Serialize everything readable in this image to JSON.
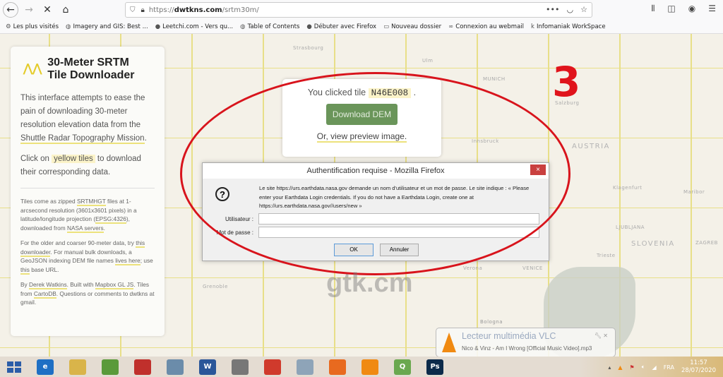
{
  "browser": {
    "url_prefix": "https://",
    "url_host": "dwtkns.com",
    "url_path": "/srtm30m/",
    "nav_icons": [
      "back-icon",
      "forward-icon",
      "stop-icon",
      "home-icon"
    ],
    "bookmarks": [
      {
        "icon": "gear-icon",
        "label": "Les plus visités"
      },
      {
        "icon": "globe-icon",
        "label": "Imagery and GIS: Best ..."
      },
      {
        "icon": "leetchi-icon",
        "label": "Leetchi.com - Vers qu..."
      },
      {
        "icon": "globe-icon",
        "label": "Table of Contents"
      },
      {
        "icon": "firefox-icon",
        "label": "Débuter avec Firefox"
      },
      {
        "icon": "folder-icon",
        "label": "Nouveau dossier"
      },
      {
        "icon": "webmail-icon",
        "label": "Connexion au webmail"
      },
      {
        "icon": "infomaniak-icon",
        "label": "Infomaniak WorkSpace"
      }
    ]
  },
  "panel": {
    "title_line1": "30-Meter SRTM",
    "title_line2": "Tile Downloader",
    "intro": "This interface attempts to ease the pain of downloading 30-meter resolution elevation data from the",
    "intro_link": "Shuttle Radar Topography Mission",
    "intro_end": ".",
    "click_pre": "Click on",
    "click_hl": "yellow tiles",
    "click_post": "to download their corresponding data.",
    "tiles_a": "Tiles come as zipped",
    "tiles_link1": "SRTMHGT",
    "tiles_b": "files at 1-arcsecond resolution (3601x3601 pixels) in a latitude/longitude projection (",
    "tiles_link2": "EPSG:4326",
    "tiles_c": "), downloaded from",
    "tiles_link3": "NASA servers",
    "tiles_d": ".",
    "older_a": "For the older and coarser 90-meter data, try",
    "older_link1": "this downloader",
    "older_b": ". For manual bulk downloads, a GeoJSON indexing DEM file names",
    "older_link2": "lives here",
    "older_c": "; use",
    "older_link3": "this",
    "older_d": "base URL.",
    "by_a": "By",
    "by_link1": "Derek Watkins",
    "by_b": ". Built with",
    "by_link2": "Mapbox GL JS",
    "by_c": ". Tiles from",
    "by_link3": "CartoDB",
    "by_d": ". Questions or comments to dwtkns at gmail."
  },
  "popup": {
    "clicked": "You clicked tile",
    "tile": "N46E008",
    "dot": ".",
    "download": "Download DEM",
    "preview": "Or, view preview image."
  },
  "dialog": {
    "title": "Authentification requise - Mozilla Firefox",
    "close": "×",
    "message": "Le site https://urs.earthdata.nasa.gov demande un nom d'utilisateur et un mot de passe. Le site indique : « Please enter your Earthdata Login credentials. If you do not have a Earthdata Login, create one at https://urs.earthdata.nasa.gov//users/new »",
    "user_label": "Utilisateur :",
    "user_value": "",
    "pass_label": "Mot de passe :",
    "pass_value": "",
    "ok": "OK",
    "cancel": "Annuler"
  },
  "map_labels": {
    "strasbourg": "Strasbourg",
    "ulm": "Ulm",
    "munich": "MUNICH",
    "salzburg": "Salzburg",
    "innsbruck": "Innsbruck",
    "austria": "AUSTRIA",
    "klagenfurt": "Klagenfurt",
    "maribor": "Maribor",
    "ljubljana": "LJUBLJANA",
    "slovenia": "SLOVENIA",
    "zagreb": "ZAGREB",
    "trieste": "Trieste",
    "venice": "VENICE",
    "verona": "Verona",
    "grenoble": "Grenoble",
    "bologna": "Bologna"
  },
  "annotation": {
    "number": "3",
    "color": "#d8141c"
  },
  "watermark": "gtk.cm",
  "vlc": {
    "title": "Lecteur multimédia VLC",
    "track": "Nico & Vinz - Am I Wrong [Official Music Video].mp3"
  },
  "taskbar": {
    "apps": [
      {
        "icon": "ie-icon",
        "color": "#1e6fc4",
        "label": "e"
      },
      {
        "icon": "explorer-icon",
        "color": "#d9b44a",
        "label": ""
      },
      {
        "icon": "globe-app-icon",
        "color": "#5a9a3a",
        "label": ""
      },
      {
        "icon": "app-icon",
        "color": "#c0302c",
        "label": ""
      },
      {
        "icon": "app-icon",
        "color": "#6b8caa",
        "label": ""
      },
      {
        "icon": "word-icon",
        "color": "#2a5699",
        "label": "W"
      },
      {
        "icon": "browser-icon",
        "color": "#777777",
        "label": ""
      },
      {
        "icon": "pdf-icon",
        "color": "#d03a2c",
        "label": ""
      },
      {
        "icon": "calculator-icon",
        "color": "#8ea4b8",
        "label": ""
      },
      {
        "icon": "firefox-icon",
        "color": "#e86a1f",
        "label": ""
      },
      {
        "icon": "vlc-icon",
        "color": "#f08a12",
        "label": ""
      },
      {
        "icon": "qgis-icon",
        "color": "#6aa84f",
        "label": "Q"
      },
      {
        "icon": "photoshop-icon",
        "color": "#0c2a4a",
        "label": "Ps"
      }
    ],
    "lang": "FRA",
    "time": "11:57",
    "date": "28/07/2020"
  },
  "colors": {
    "accent_yellow": "#e8df88",
    "download_green": "#6a955a",
    "dialog_close": "#c9403f"
  }
}
